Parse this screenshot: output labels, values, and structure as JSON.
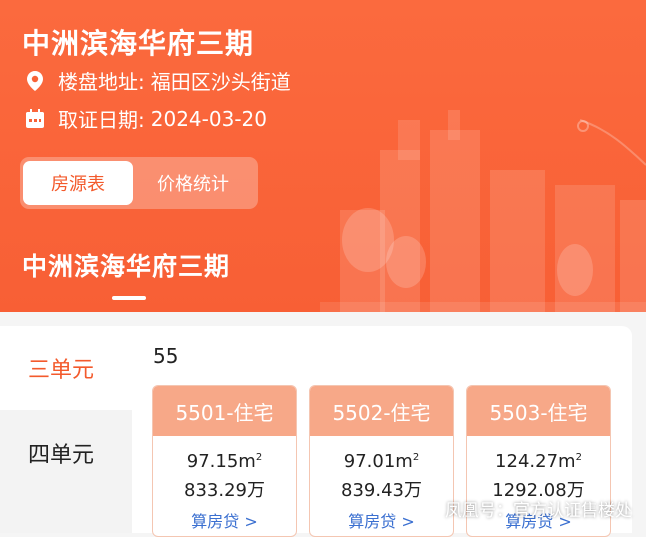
{
  "header": {
    "title": "中洲滨海华府三期",
    "address_label": "楼盘地址:",
    "address_value": "福田区沙头街道",
    "date_label": "取证日期:",
    "date_value": "2024-03-20"
  },
  "tabs": [
    {
      "label": "房源表",
      "active": true
    },
    {
      "label": "价格统计",
      "active": false
    }
  ],
  "section": {
    "title": "中洲滨海华府三期"
  },
  "units": [
    {
      "label": "三单元",
      "active": true
    },
    {
      "label": "四单元",
      "active": false
    }
  ],
  "floor": "55",
  "cards": [
    {
      "title": "5501-住宅",
      "area": "97.15",
      "area_unit": "m",
      "area_sup": "2",
      "price": "833.29万",
      "link": "算房贷 >"
    },
    {
      "title": "5502-住宅",
      "area": "97.01",
      "area_unit": "m",
      "area_sup": "2",
      "price": "839.43万",
      "link": "算房贷 >"
    },
    {
      "title": "5503-住宅",
      "area": "124.27",
      "area_unit": "m",
      "area_sup": "2",
      "price": "1292.08万",
      "link": "算房贷 >"
    }
  ],
  "watermark": "凤凰号：官方认证售楼处",
  "colors": {
    "brand": "#f85f35",
    "card_head": "#f7a888",
    "accent_text": "#f35a2c"
  }
}
